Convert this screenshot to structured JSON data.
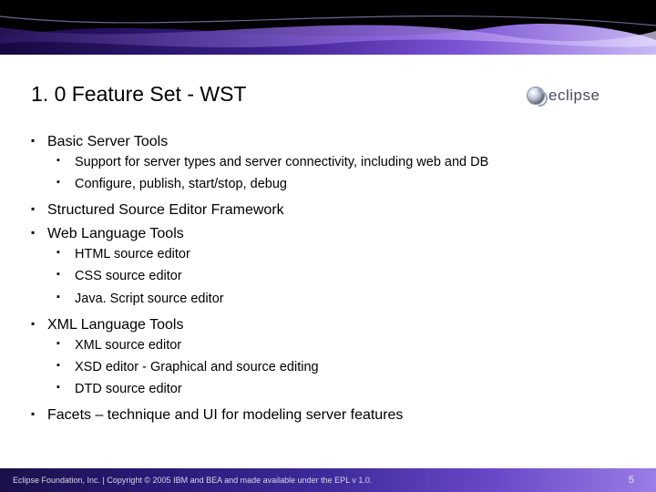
{
  "title": "1. 0 Feature Set - WST",
  "logo_text": "eclipse",
  "page_number": "5",
  "footer": "Eclipse Foundation, Inc. | Copyright © 2005 IBM and BEA and made available under the EPL v 1.0.",
  "bullets": [
    {
      "level": 1,
      "text": "Basic Server Tools"
    },
    {
      "level": 2,
      "text": "Support for server types and server connectivity, including web and DB"
    },
    {
      "level": 2,
      "text": "Configure, publish, start/stop, debug"
    },
    {
      "level": 1,
      "text": "Structured Source Editor Framework"
    },
    {
      "level": 1,
      "text": "Web Language Tools"
    },
    {
      "level": 2,
      "text": "HTML source editor"
    },
    {
      "level": 2,
      "text": "CSS source editor"
    },
    {
      "level": 2,
      "text": "Java. Script source editor"
    },
    {
      "level": 1,
      "text": "XML Language Tools"
    },
    {
      "level": 2,
      "text": "XML source editor"
    },
    {
      "level": 2,
      "text": "XSD editor - Graphical and source editing"
    },
    {
      "level": 2,
      "text": "DTD source editor"
    },
    {
      "level": 1,
      "text": "Facets – technique and UI for modeling server features"
    }
  ]
}
